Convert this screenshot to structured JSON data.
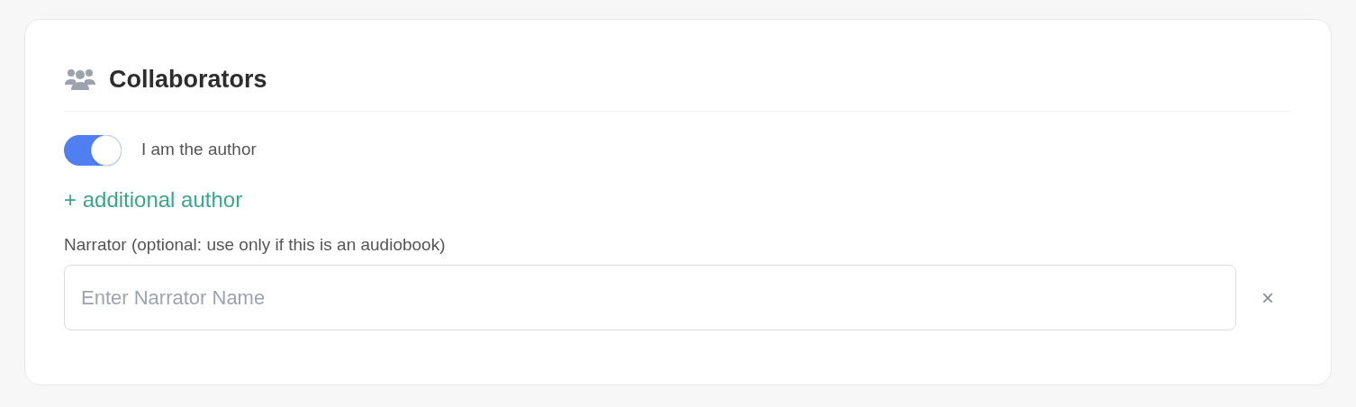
{
  "section": {
    "title": "Collaborators"
  },
  "author_toggle": {
    "label": "I am the author",
    "on": true
  },
  "add_author_link": "+ additional author",
  "narrator": {
    "label": "Narrator (optional: use only if this is an audiobook)",
    "placeholder": "Enter Narrator Name",
    "clear": "×"
  }
}
